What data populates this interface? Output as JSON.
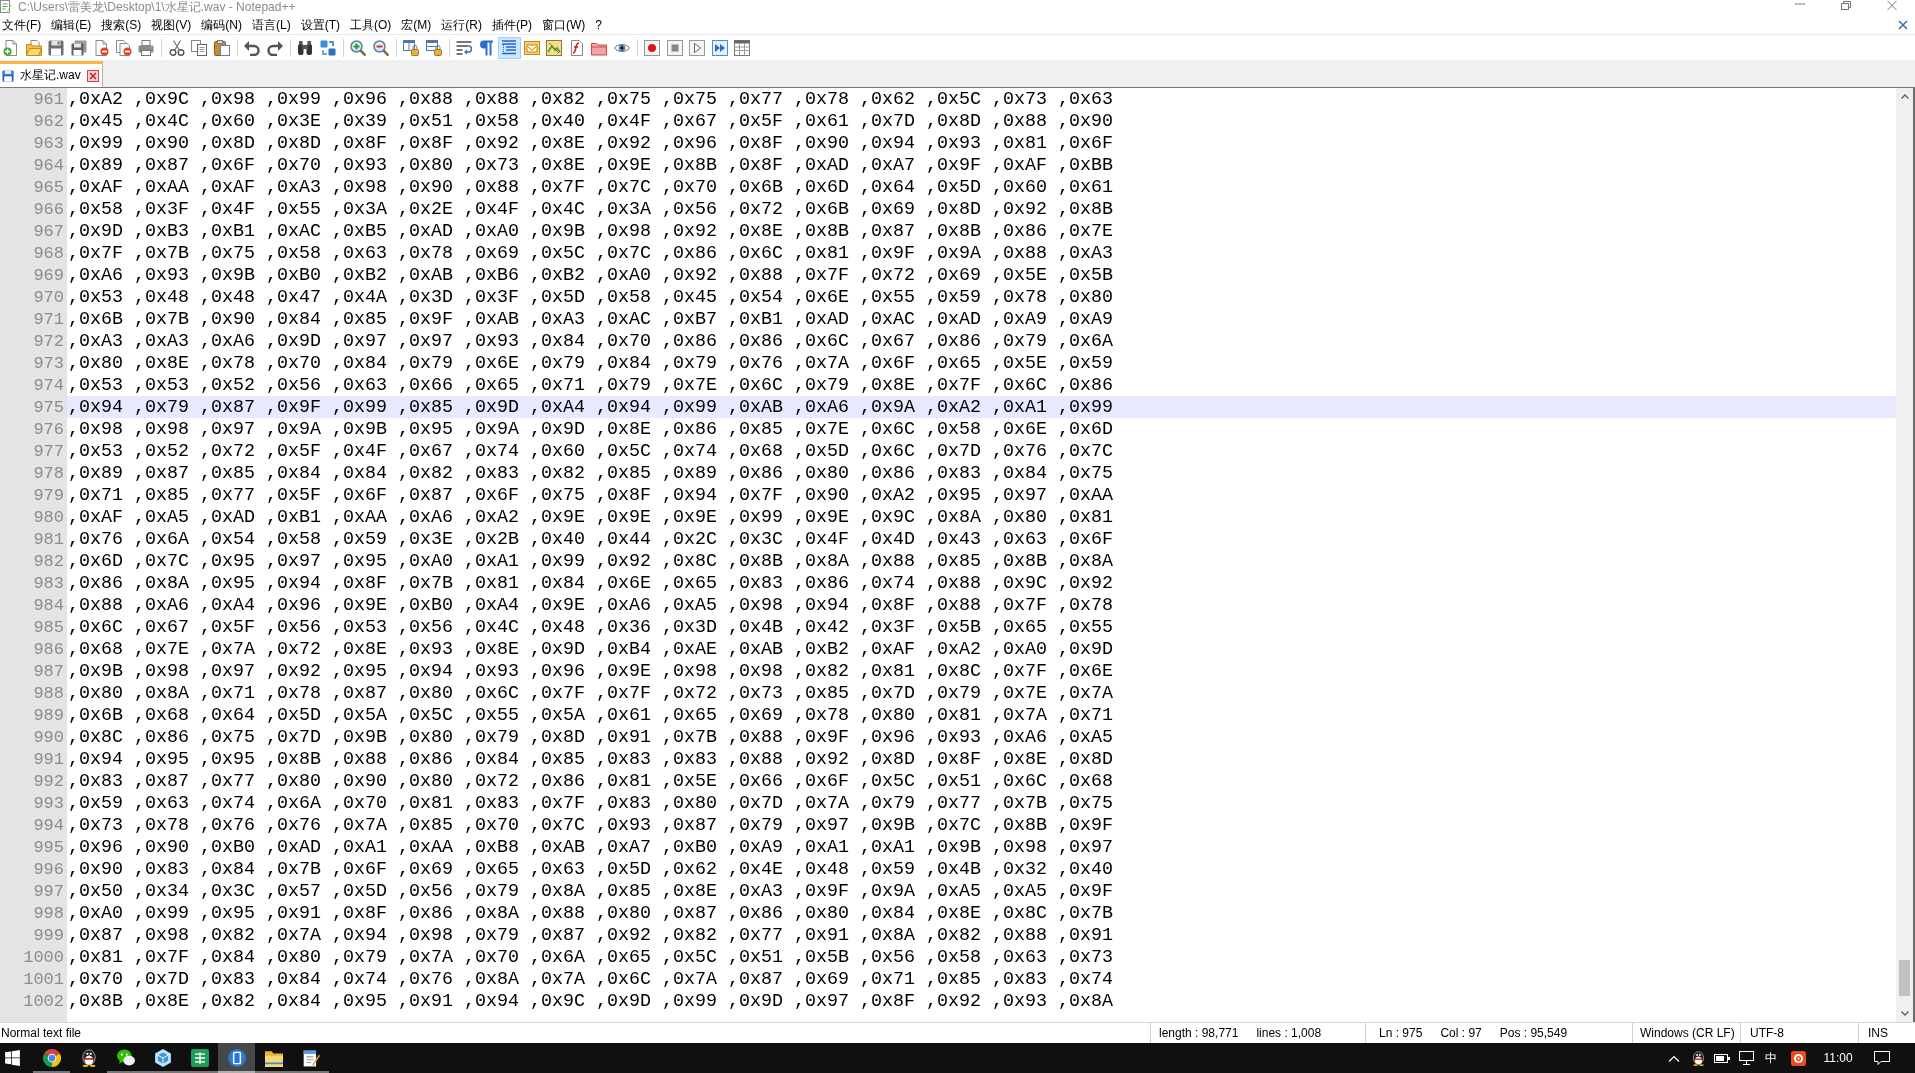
{
  "window": {
    "title": "C:\\Users\\雷美龙\\Desktop\\1\\水星记.wav - Notepad++"
  },
  "menu": [
    "文件(F)",
    "编辑(E)",
    "搜索(S)",
    "视图(V)",
    "编码(N)",
    "语言(L)",
    "设置(T)",
    "工具(O)",
    "宏(M)",
    "运行(R)",
    "插件(P)",
    "窗口(W)",
    "?"
  ],
  "toolbar": {
    "buttons": [
      {
        "on": false
      },
      {
        "on": false
      },
      {
        "on": false
      },
      {
        "on": false
      },
      {
        "on": false
      },
      {
        "on": false
      },
      {
        "on": false
      },
      {
        "on": false
      },
      {
        "on": false
      },
      {
        "on": false
      },
      {
        "on": false
      },
      {
        "on": false
      },
      {
        "on": false
      },
      {
        "on": false
      },
      {
        "on": false
      },
      {
        "on": false
      },
      {
        "on": false
      },
      {
        "on": false
      },
      {
        "on": false
      },
      {
        "on": false
      },
      {
        "on": true
      },
      {
        "on": false
      },
      {
        "on": false
      },
      {
        "on": false
      },
      {
        "on": false
      },
      {
        "on": false
      },
      {
        "on": false
      },
      {
        "on": false
      },
      {
        "on": false
      },
      {
        "on": false
      },
      {
        "on": false
      }
    ]
  },
  "tabs": [
    {
      "label": "水星记.wav",
      "selected": true
    }
  ],
  "editor": {
    "lines": [
      {
        "number": "961",
        "text": ",0xA2 ,0x9C ,0x98 ,0x99 ,0x96 ,0x88 ,0x88 ,0x82 ,0x75 ,0x75 ,0x77 ,0x78 ,0x62 ,0x5C ,0x73 ,0x63",
        "current": false
      },
      {
        "number": "962",
        "text": ",0x45 ,0x4C ,0x60 ,0x3E ,0x39 ,0x51 ,0x58 ,0x40 ,0x4F ,0x67 ,0x5F ,0x61 ,0x7D ,0x8D ,0x88 ,0x90",
        "current": false
      },
      {
        "number": "963",
        "text": ",0x99 ,0x90 ,0x8D ,0x8D ,0x8F ,0x8F ,0x92 ,0x8E ,0x92 ,0x96 ,0x8F ,0x90 ,0x94 ,0x93 ,0x81 ,0x6F",
        "current": false
      },
      {
        "number": "964",
        "text": ",0x89 ,0x87 ,0x6F ,0x70 ,0x93 ,0x80 ,0x73 ,0x8E ,0x9E ,0x8B ,0x8F ,0xAD ,0xA7 ,0x9F ,0xAF ,0xBB",
        "current": false
      },
      {
        "number": "965",
        "text": ",0xAF ,0xAA ,0xAF ,0xA3 ,0x98 ,0x90 ,0x88 ,0x7F ,0x7C ,0x70 ,0x6B ,0x6D ,0x64 ,0x5D ,0x60 ,0x61",
        "current": false
      },
      {
        "number": "966",
        "text": ",0x58 ,0x3F ,0x4F ,0x55 ,0x3A ,0x2E ,0x4F ,0x4C ,0x3A ,0x56 ,0x72 ,0x6B ,0x69 ,0x8D ,0x92 ,0x8B",
        "current": false
      },
      {
        "number": "967",
        "text": ",0x9D ,0xB3 ,0xB1 ,0xAC ,0xB5 ,0xAD ,0xA0 ,0x9B ,0x98 ,0x92 ,0x8E ,0x8B ,0x87 ,0x8B ,0x86 ,0x7E",
        "current": false
      },
      {
        "number": "968",
        "text": ",0x7F ,0x7B ,0x75 ,0x58 ,0x63 ,0x78 ,0x69 ,0x5C ,0x7C ,0x86 ,0x6C ,0x81 ,0x9F ,0x9A ,0x88 ,0xA3",
        "current": false
      },
      {
        "number": "969",
        "text": ",0xA6 ,0x93 ,0x9B ,0xB0 ,0xB2 ,0xAB ,0xB6 ,0xB2 ,0xA0 ,0x92 ,0x88 ,0x7F ,0x72 ,0x69 ,0x5E ,0x5B",
        "current": false
      },
      {
        "number": "970",
        "text": ",0x53 ,0x48 ,0x48 ,0x47 ,0x4A ,0x3D ,0x3F ,0x5D ,0x58 ,0x45 ,0x54 ,0x6E ,0x55 ,0x59 ,0x78 ,0x80",
        "current": false
      },
      {
        "number": "971",
        "text": ",0x6B ,0x7B ,0x90 ,0x84 ,0x85 ,0x9F ,0xAB ,0xA3 ,0xAC ,0xB7 ,0xB1 ,0xAD ,0xAC ,0xAD ,0xA9 ,0xA9",
        "current": false
      },
      {
        "number": "972",
        "text": ",0xA3 ,0xA3 ,0xA6 ,0x9D ,0x97 ,0x97 ,0x93 ,0x84 ,0x70 ,0x86 ,0x86 ,0x6C ,0x67 ,0x86 ,0x79 ,0x6A",
        "current": false
      },
      {
        "number": "973",
        "text": ",0x80 ,0x8E ,0x78 ,0x70 ,0x84 ,0x79 ,0x6E ,0x79 ,0x84 ,0x79 ,0x76 ,0x7A ,0x6F ,0x65 ,0x5E ,0x59",
        "current": false
      },
      {
        "number": "974",
        "text": ",0x53 ,0x53 ,0x52 ,0x56 ,0x63 ,0x66 ,0x65 ,0x71 ,0x79 ,0x7E ,0x6C ,0x79 ,0x8E ,0x7F ,0x6C ,0x86",
        "current": false
      },
      {
        "number": "975",
        "text": ",0x94 ,0x79 ,0x87 ,0x9F ,0x99 ,0x85 ,0x9D ,0xA4 ,0x94 ,0x99 ,0xAB ,0xA6 ,0x9A ,0xA2 ,0xA1 ,0x99",
        "current": true
      },
      {
        "number": "976",
        "text": ",0x98 ,0x98 ,0x97 ,0x9A ,0x9B ,0x95 ,0x9A ,0x9D ,0x8E ,0x86 ,0x85 ,0x7E ,0x6C ,0x58 ,0x6E ,0x6D",
        "current": false
      },
      {
        "number": "977",
        "text": ",0x53 ,0x52 ,0x72 ,0x5F ,0x4F ,0x67 ,0x74 ,0x60 ,0x5C ,0x74 ,0x68 ,0x5D ,0x6C ,0x7D ,0x76 ,0x7C",
        "current": false
      },
      {
        "number": "978",
        "text": ",0x89 ,0x87 ,0x85 ,0x84 ,0x84 ,0x82 ,0x83 ,0x82 ,0x85 ,0x89 ,0x86 ,0x80 ,0x86 ,0x83 ,0x84 ,0x75",
        "current": false
      },
      {
        "number": "979",
        "text": ",0x71 ,0x85 ,0x77 ,0x5F ,0x6F ,0x87 ,0x6F ,0x75 ,0x8F ,0x94 ,0x7F ,0x90 ,0xA2 ,0x95 ,0x97 ,0xAA",
        "current": false
      },
      {
        "number": "980",
        "text": ",0xAF ,0xA5 ,0xAD ,0xB1 ,0xAA ,0xA6 ,0xA2 ,0x9E ,0x9E ,0x9E ,0x99 ,0x9E ,0x9C ,0x8A ,0x80 ,0x81",
        "current": false
      },
      {
        "number": "981",
        "text": ",0x76 ,0x6A ,0x54 ,0x58 ,0x59 ,0x3E ,0x2B ,0x40 ,0x44 ,0x2C ,0x3C ,0x4F ,0x4D ,0x43 ,0x63 ,0x6F",
        "current": false
      },
      {
        "number": "982",
        "text": ",0x6D ,0x7C ,0x95 ,0x97 ,0x95 ,0xA0 ,0xA1 ,0x99 ,0x92 ,0x8C ,0x8B ,0x8A ,0x88 ,0x85 ,0x8B ,0x8A",
        "current": false
      },
      {
        "number": "983",
        "text": ",0x86 ,0x8A ,0x95 ,0x94 ,0x8F ,0x7B ,0x81 ,0x84 ,0x6E ,0x65 ,0x83 ,0x86 ,0x74 ,0x88 ,0x9C ,0x92",
        "current": false
      },
      {
        "number": "984",
        "text": ",0x88 ,0xA6 ,0xA4 ,0x96 ,0x9E ,0xB0 ,0xA4 ,0x9E ,0xA6 ,0xA5 ,0x98 ,0x94 ,0x8F ,0x88 ,0x7F ,0x78",
        "current": false
      },
      {
        "number": "985",
        "text": ",0x6C ,0x67 ,0x5F ,0x56 ,0x53 ,0x56 ,0x4C ,0x48 ,0x36 ,0x3D ,0x4B ,0x42 ,0x3F ,0x5B ,0x65 ,0x55",
        "current": false
      },
      {
        "number": "986",
        "text": ",0x68 ,0x7E ,0x7A ,0x72 ,0x8E ,0x93 ,0x8E ,0x9D ,0xB4 ,0xAE ,0xAB ,0xB2 ,0xAF ,0xA2 ,0xA0 ,0x9D",
        "current": false
      },
      {
        "number": "987",
        "text": ",0x9B ,0x98 ,0x97 ,0x92 ,0x95 ,0x94 ,0x93 ,0x96 ,0x9E ,0x98 ,0x98 ,0x82 ,0x81 ,0x8C ,0x7F ,0x6E",
        "current": false
      },
      {
        "number": "988",
        "text": ",0x80 ,0x8A ,0x71 ,0x78 ,0x87 ,0x80 ,0x6C ,0x7F ,0x7F ,0x72 ,0x73 ,0x85 ,0x7D ,0x79 ,0x7E ,0x7A",
        "current": false
      },
      {
        "number": "989",
        "text": ",0x6B ,0x68 ,0x64 ,0x5D ,0x5A ,0x5C ,0x55 ,0x5A ,0x61 ,0x65 ,0x69 ,0x78 ,0x80 ,0x81 ,0x7A ,0x71",
        "current": false
      },
      {
        "number": "990",
        "text": ",0x8C ,0x86 ,0x75 ,0x7D ,0x9B ,0x80 ,0x79 ,0x8D ,0x91 ,0x7B ,0x88 ,0x9F ,0x96 ,0x93 ,0xA6 ,0xA5",
        "current": false
      },
      {
        "number": "991",
        "text": ",0x94 ,0x95 ,0x95 ,0x8B ,0x88 ,0x86 ,0x84 ,0x85 ,0x83 ,0x83 ,0x88 ,0x92 ,0x8D ,0x8F ,0x8E ,0x8D",
        "current": false
      },
      {
        "number": "992",
        "text": ",0x83 ,0x87 ,0x77 ,0x80 ,0x90 ,0x80 ,0x72 ,0x86 ,0x81 ,0x5E ,0x66 ,0x6F ,0x5C ,0x51 ,0x6C ,0x68",
        "current": false
      },
      {
        "number": "993",
        "text": ",0x59 ,0x63 ,0x74 ,0x6A ,0x70 ,0x81 ,0x83 ,0x7F ,0x83 ,0x80 ,0x7D ,0x7A ,0x79 ,0x77 ,0x7B ,0x75",
        "current": false
      },
      {
        "number": "994",
        "text": ",0x73 ,0x78 ,0x76 ,0x76 ,0x7A ,0x85 ,0x70 ,0x7C ,0x93 ,0x87 ,0x79 ,0x97 ,0x9B ,0x7C ,0x8B ,0x9F",
        "current": false
      },
      {
        "number": "995",
        "text": ",0x96 ,0x90 ,0xB0 ,0xAD ,0xA1 ,0xAA ,0xB8 ,0xAB ,0xA7 ,0xB0 ,0xA9 ,0xA1 ,0xA1 ,0x9B ,0x98 ,0x97",
        "current": false
      },
      {
        "number": "996",
        "text": ",0x90 ,0x83 ,0x84 ,0x7B ,0x6F ,0x69 ,0x65 ,0x63 ,0x5D ,0x62 ,0x4E ,0x48 ,0x59 ,0x4B ,0x32 ,0x40",
        "current": false
      },
      {
        "number": "997",
        "text": ",0x50 ,0x34 ,0x3C ,0x57 ,0x5D ,0x56 ,0x79 ,0x8A ,0x85 ,0x8E ,0xA3 ,0x9F ,0x9A ,0xA5 ,0xA5 ,0x9F",
        "current": false
      },
      {
        "number": "998",
        "text": ",0xA0 ,0x99 ,0x95 ,0x91 ,0x8F ,0x86 ,0x8A ,0x88 ,0x80 ,0x87 ,0x86 ,0x80 ,0x84 ,0x8E ,0x8C ,0x7B",
        "current": false
      },
      {
        "number": "999",
        "text": ",0x87 ,0x98 ,0x82 ,0x7A ,0x94 ,0x98 ,0x79 ,0x87 ,0x92 ,0x82 ,0x77 ,0x91 ,0x8A ,0x82 ,0x88 ,0x91",
        "current": false
      },
      {
        "number": "1000",
        "text": ",0x81 ,0x7F ,0x84 ,0x80 ,0x79 ,0x7A ,0x70 ,0x6A ,0x65 ,0x5C ,0x51 ,0x5B ,0x56 ,0x58 ,0x63 ,0x73",
        "current": false
      },
      {
        "number": "1001",
        "text": ",0x70 ,0x7D ,0x83 ,0x84 ,0x74 ,0x76 ,0x8A ,0x7A ,0x6C ,0x7A ,0x87 ,0x69 ,0x71 ,0x85 ,0x83 ,0x74",
        "current": false
      },
      {
        "number": "1002",
        "text": ",0x8B ,0x8E ,0x82 ,0x84 ,0x95 ,0x91 ,0x94 ,0x9C ,0x9D ,0x99 ,0x9D ,0x97 ,0x8F ,0x92 ,0x93 ,0x8A",
        "current": false
      }
    ]
  },
  "status_bar": {
    "file_type": "Normal text file",
    "length": "length : 98,771",
    "lines": "lines : 1,008",
    "ln": "Ln : 975",
    "col": "Col : 97",
    "pos": "Pos : 95,549",
    "eol": "Windows (CR LF)",
    "encoding": "UTF-8",
    "mode": "INS"
  },
  "taskbar": {
    "apps": [
      {
        "selected": false,
        "running": true
      },
      {
        "selected": false,
        "running": false
      },
      {
        "selected": false,
        "running": true
      },
      {
        "selected": false,
        "running": true
      },
      {
        "selected": false,
        "running": true
      },
      {
        "selected": true,
        "running": true
      },
      {
        "selected": false,
        "running": true
      },
      {
        "selected": false,
        "running": true
      }
    ],
    "tray": {
      "input_method": "中",
      "clock": "11:00"
    }
  }
}
